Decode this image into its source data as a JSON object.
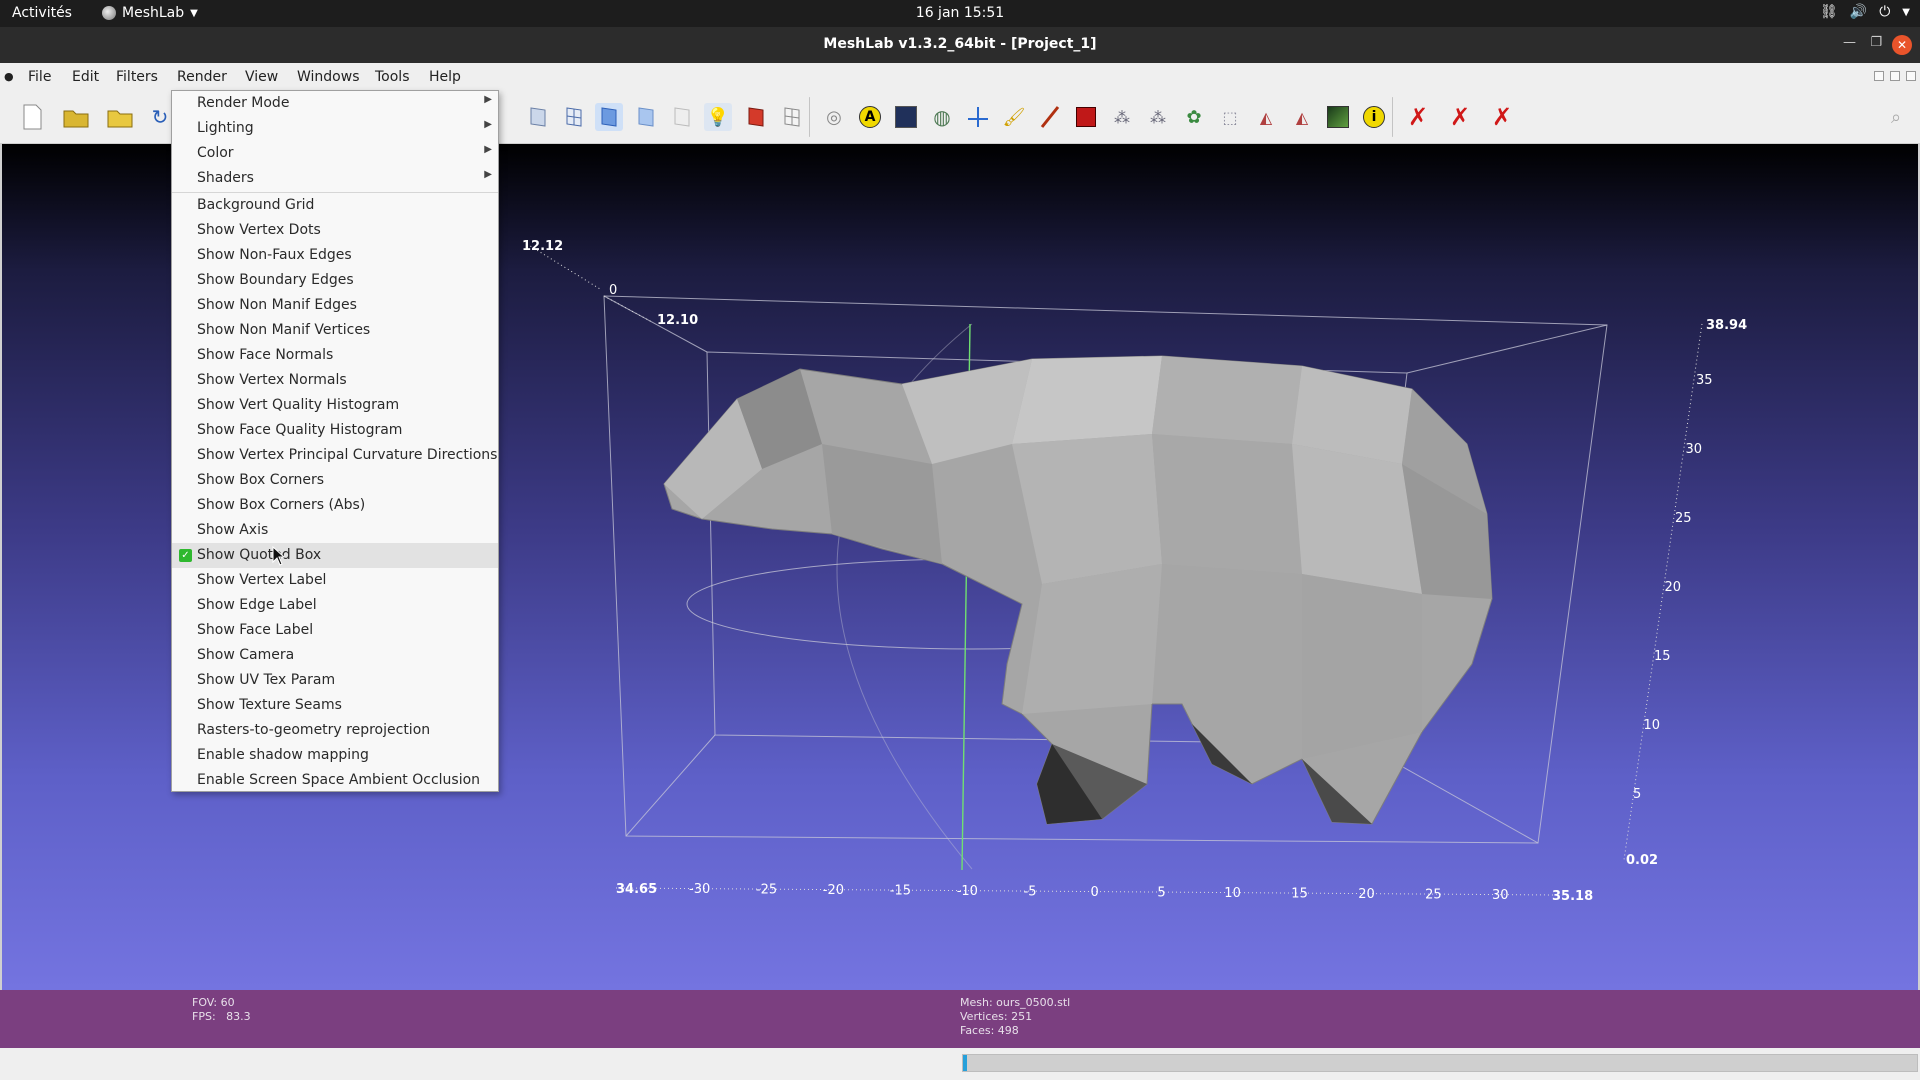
{
  "system_bar": {
    "activities": "Activités",
    "app_name": "MeshLab",
    "clock": "16 jan  15:51"
  },
  "window": {
    "title": "MeshLab v1.3.2_64bit - [Project_1]"
  },
  "menubar": {
    "items": [
      "File",
      "Edit",
      "Filters",
      "Render",
      "View",
      "Windows",
      "Tools",
      "Help"
    ]
  },
  "toolbar": {
    "icons": [
      "new-file-icon",
      "open-folder-icon",
      "open-project-icon",
      "reload-icon",
      "render-mode-icons",
      "light-icon",
      "texture-icon",
      "trackball-icon",
      "annotation-icon",
      "raster-icon",
      "select-vertex-icon",
      "measure-icon",
      "paint-icon",
      "brush-icon",
      "color-picker-icon",
      "select-faces-icon",
      "select-connected-icon",
      "align-icon",
      "georef-icon",
      "edit-icon",
      "pick-points-icon",
      "info-icon",
      "delete-x-icon",
      "delete-x-2-icon",
      "delete-x-3-icon"
    ]
  },
  "render_menu": {
    "submenus": [
      "Render Mode",
      "Lighting",
      "Color",
      "Shaders"
    ],
    "items": [
      "Background Grid",
      "Show Vertex Dots",
      "Show Non-Faux Edges",
      "Show Boundary Edges",
      "Show Non Manif Edges",
      "Show Non Manif Vertices",
      "Show Face Normals",
      "Show Vertex Normals",
      "Show Vert Quality Histogram",
      "Show Face Quality Histogram",
      "Show Vertex Principal Curvature Directions",
      "Show Box Corners",
      "Show Box Corners (Abs)",
      "Show Axis",
      "Show Quoted Box",
      "Show Vertex Label",
      "Show Edge Label",
      "Show Face Label",
      "Show Camera",
      "Show UV Tex Param",
      "Show Texture Seams",
      "Rasters-to-geometry reprojection",
      "Enable shadow mapping",
      "Enable Screen Space Ambient Occlusion"
    ],
    "checked_item": "Show Quoted Box"
  },
  "quoted_box": {
    "z_top": "12.12",
    "z_zero": "0",
    "z_label2": "12.10",
    "y_max": "38.94",
    "y_min": "0.02",
    "y_ticks": [
      "35",
      "30",
      "25",
      "20",
      "15",
      "10",
      "5"
    ],
    "x_min": "34.65",
    "x_max": "35.18",
    "x_ticks": [
      "-30",
      "-25",
      "-20",
      "-15",
      "-10",
      "-5",
      "0",
      "5",
      "10",
      "15",
      "20",
      "25",
      "30"
    ]
  },
  "info": {
    "fov": "FOV: 60",
    "fps_label": "FPS:",
    "fps_value": "83.3",
    "mesh": "Mesh: ours_0500.stl",
    "vertices": "Vertices: 251",
    "faces": "Faces: 498"
  },
  "progress": {
    "value": 0.004
  },
  "colors": {
    "info_bar": "#7b3f80",
    "checkmark": "#2eb82e",
    "close_button": "#e9542b"
  }
}
